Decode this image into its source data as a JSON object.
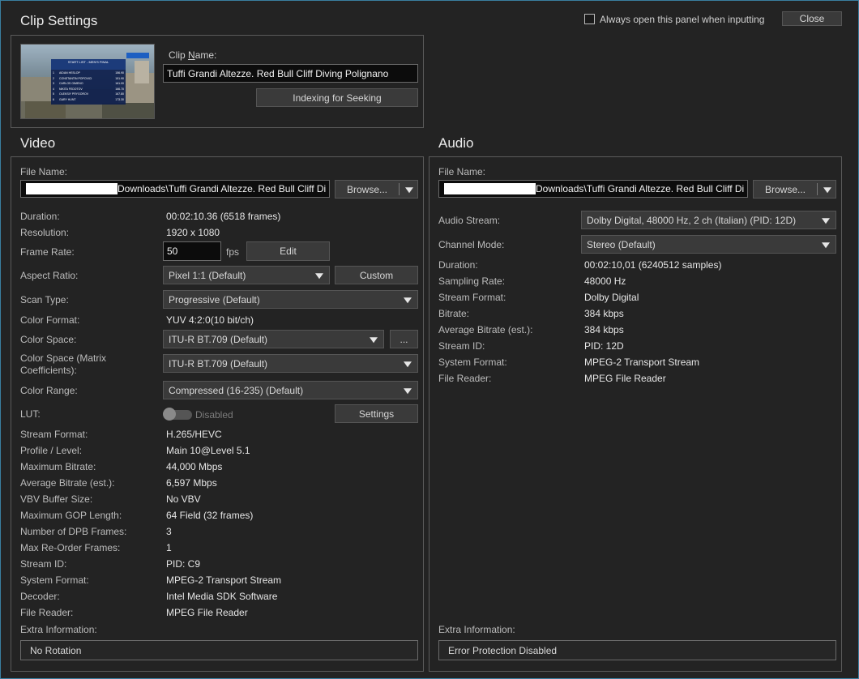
{
  "header": {
    "title": "Clip Settings",
    "always_open_label": "Always open this panel when inputting",
    "close_label": "Close"
  },
  "clip": {
    "name_label_pre": "Clip ",
    "name_label_u": "N",
    "name_label_post": "ame:",
    "name_value": "Tuffi Grandi Altezze. Red Bull Cliff Diving Polignano",
    "indexing_label": "Indexing for Seeking"
  },
  "video": {
    "section_title": "Video",
    "file_name_label": "File Name:",
    "file_name_value": "Downloads\\Tuffi Grandi Altezze. Red Bull Cliff Di",
    "browse_label": "Browse...",
    "duration_label": "Duration:",
    "duration_value": "00:02:10.36 (6518  frames)",
    "resolution_label": "Resolution:",
    "resolution_value": "1920 x 1080",
    "frame_rate_label": "Frame Rate:",
    "frame_rate_value": "50",
    "fps_label": "fps",
    "edit_label": "Edit",
    "aspect_label": "Aspect Ratio:",
    "aspect_value": "Pixel 1:1 (Default)",
    "custom_label": "Custom",
    "scan_label": "Scan Type:",
    "scan_value": "Progressive (Default)",
    "color_format_label": "Color Format:",
    "color_format_value": "YUV 4:2:0(10 bit/ch)",
    "color_space_label": "Color Space:",
    "color_space_value": "ITU-R BT.709 (Default)",
    "more_label": "...",
    "matrix_label_1": "Color Space (Matrix",
    "matrix_label_2": "Coefficients):",
    "matrix_value": "ITU-R BT.709 (Default)",
    "range_label": "Color Range:",
    "range_value": "Compressed (16-235) (Default)",
    "lut_label": "LUT:",
    "lut_state": "Disabled",
    "settings_label": "Settings",
    "info_rows": [
      {
        "label": "Stream Format:",
        "value": "H.265/HEVC"
      },
      {
        "label": "Profile / Level:",
        "value": "Main 10@Level 5.1"
      },
      {
        "label": "Maximum Bitrate:",
        "value": "44,000 Mbps"
      },
      {
        "label": "Average Bitrate (est.):",
        "value": "6,597 Mbps"
      },
      {
        "label": "VBV Buffer Size:",
        "value": "No VBV"
      },
      {
        "label": "Maximum GOP Length:",
        "value": "64 Field (32  frames)"
      },
      {
        "label": "Number of DPB Frames:",
        "value": "3"
      },
      {
        "label": "Max Re-Order Frames:",
        "value": "1"
      },
      {
        "label": "Stream ID:",
        "value": "PID: C9"
      },
      {
        "label": "System Format:",
        "value": "MPEG-2 Transport Stream"
      },
      {
        "label": "Decoder:",
        "value": "Intel Media SDK Software"
      },
      {
        "label": "File Reader:",
        "value": "MPEG File Reader"
      }
    ],
    "extra_label": "Extra Information:",
    "extra_value": "No Rotation"
  },
  "audio": {
    "section_title": "Audio",
    "file_name_label": "File Name:",
    "file_name_value": "Downloads\\Tuffi Grandi Altezze. Red Bull Cliff Di",
    "browse_label": "Browse...",
    "stream_label": "Audio Stream:",
    "stream_value": "Dolby Digital, 48000 Hz, 2 ch (Italian) (PID: 12D)",
    "channel_label": "Channel Mode:",
    "channel_value": "Stereo (Default)",
    "info_rows": [
      {
        "label": "Duration:",
        "value": "00:02:10,01 (6240512  samples)"
      },
      {
        "label": "Sampling Rate:",
        "value": "48000 Hz"
      },
      {
        "label": "Stream Format:",
        "value": "Dolby Digital"
      },
      {
        "label": "Bitrate:",
        "value": "384 kbps"
      },
      {
        "label": "Average Bitrate (est.):",
        "value": "384 kbps"
      },
      {
        "label": "Stream ID:",
        "value": "PID: 12D"
      },
      {
        "label": "System Format:",
        "value": "MPEG-2 Transport Stream"
      },
      {
        "label": "File Reader:",
        "value": "MPEG File Reader"
      }
    ],
    "extra_label": "Extra Information:",
    "extra_value": "Error Protection Disabled"
  },
  "thumbnail": {
    "overlay_title": "START LIST - MEN'S FINAL",
    "rows": [
      {
        "num": "1",
        "name": "AIDAN HESLOP",
        "score": "156.90"
      },
      {
        "num": "2",
        "name": "CONSTANTIN POPOVICI",
        "score": "151.90"
      },
      {
        "num": "3",
        "name": "CARLOS GIMENO",
        "score": "161.00"
      },
      {
        "num": "4",
        "name": "NIKITA FEDOTOV",
        "score": "166.70"
      },
      {
        "num": "5",
        "name": "OLEKSIY PRYGOROV",
        "score": "167.80"
      },
      {
        "num": "6",
        "name": "GARY HUNT",
        "score": "173.30"
      }
    ]
  }
}
